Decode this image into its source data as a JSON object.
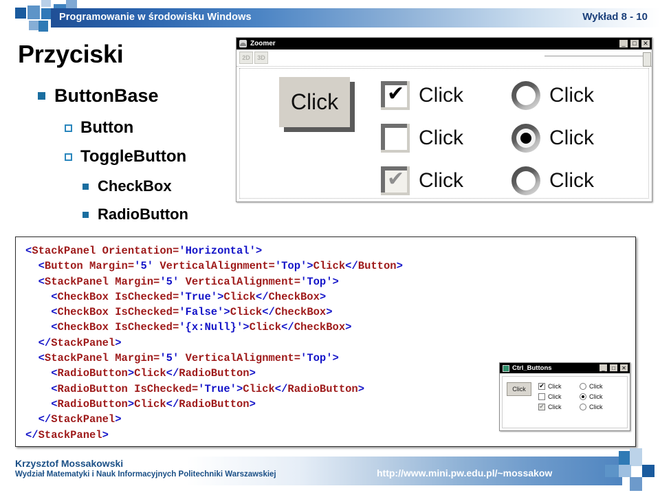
{
  "header": {
    "title": "Programowanie w środowisku Windows",
    "lecture": "Wykład 8 - 10"
  },
  "slide": {
    "title": "Przyciski",
    "bullets": [
      {
        "label": "ButtonBase",
        "marker": "filled-square"
      },
      {
        "label": "Button",
        "marker": "hollow-square"
      },
      {
        "label": "ToggleButton",
        "marker": "hollow-square"
      },
      {
        "label": "CheckBox",
        "marker": "filled-square-small"
      },
      {
        "label": "RadioButton",
        "marker": "filled-square-small"
      }
    ]
  },
  "zoomer_window": {
    "title": "Zoomer",
    "tools": [
      "2D",
      "3D"
    ],
    "controls": {
      "minimize": "_",
      "maximize": "□",
      "close": "✕"
    },
    "button_label": "Click",
    "checkboxes": [
      {
        "label": "Click",
        "state": "checked"
      },
      {
        "label": "Click",
        "state": "unchecked"
      },
      {
        "label": "Click",
        "state": "indeterminate"
      }
    ],
    "radios": [
      {
        "label": "Click",
        "state": "unselected"
      },
      {
        "label": "Click",
        "state": "selected"
      },
      {
        "label": "Click",
        "state": "unselected"
      }
    ]
  },
  "code": {
    "lines": [
      [
        {
          "t": "<",
          "c": "b"
        },
        {
          "t": "StackPanel ",
          "c": "r"
        },
        {
          "t": "Orientation=",
          "c": "r"
        },
        {
          "t": "'Horizontal'",
          "c": "b"
        },
        {
          "t": ">",
          "c": "b"
        }
      ],
      [
        {
          "t": "  <",
          "c": "b"
        },
        {
          "t": "Button ",
          "c": "r"
        },
        {
          "t": "Margin=",
          "c": "r"
        },
        {
          "t": "'5' ",
          "c": "b"
        },
        {
          "t": "VerticalAlignment=",
          "c": "r"
        },
        {
          "t": "'Top'",
          "c": "b"
        },
        {
          "t": ">",
          "c": "b"
        },
        {
          "t": "Click",
          "c": "r"
        },
        {
          "t": "</",
          "c": "b"
        },
        {
          "t": "Button",
          "c": "r"
        },
        {
          "t": ">",
          "c": "b"
        }
      ],
      [
        {
          "t": "  <",
          "c": "b"
        },
        {
          "t": "StackPanel ",
          "c": "r"
        },
        {
          "t": "Margin=",
          "c": "r"
        },
        {
          "t": "'5' ",
          "c": "b"
        },
        {
          "t": "VerticalAlignment=",
          "c": "r"
        },
        {
          "t": "'Top'",
          "c": "b"
        },
        {
          "t": ">",
          "c": "b"
        }
      ],
      [
        {
          "t": "    <",
          "c": "b"
        },
        {
          "t": "CheckBox ",
          "c": "r"
        },
        {
          "t": "IsChecked=",
          "c": "r"
        },
        {
          "t": "'True'",
          "c": "b"
        },
        {
          "t": ">",
          "c": "b"
        },
        {
          "t": "Click",
          "c": "r"
        },
        {
          "t": "</",
          "c": "b"
        },
        {
          "t": "CheckBox",
          "c": "r"
        },
        {
          "t": ">",
          "c": "b"
        }
      ],
      [
        {
          "t": "    <",
          "c": "b"
        },
        {
          "t": "CheckBox ",
          "c": "r"
        },
        {
          "t": "IsChecked=",
          "c": "r"
        },
        {
          "t": "'False'",
          "c": "b"
        },
        {
          "t": ">",
          "c": "b"
        },
        {
          "t": "Click",
          "c": "r"
        },
        {
          "t": "</",
          "c": "b"
        },
        {
          "t": "CheckBox",
          "c": "r"
        },
        {
          "t": ">",
          "c": "b"
        }
      ],
      [
        {
          "t": "    <",
          "c": "b"
        },
        {
          "t": "CheckBox ",
          "c": "r"
        },
        {
          "t": "IsChecked=",
          "c": "r"
        },
        {
          "t": "'{x:Null}'",
          "c": "b"
        },
        {
          "t": ">",
          "c": "b"
        },
        {
          "t": "Click",
          "c": "r"
        },
        {
          "t": "</",
          "c": "b"
        },
        {
          "t": "CheckBox",
          "c": "r"
        },
        {
          "t": ">",
          "c": "b"
        }
      ],
      [
        {
          "t": "  </",
          "c": "b"
        },
        {
          "t": "StackPanel",
          "c": "r"
        },
        {
          "t": ">",
          "c": "b"
        }
      ],
      [
        {
          "t": "  <",
          "c": "b"
        },
        {
          "t": "StackPanel ",
          "c": "r"
        },
        {
          "t": "Margin=",
          "c": "r"
        },
        {
          "t": "'5' ",
          "c": "b"
        },
        {
          "t": "VerticalAlignment=",
          "c": "r"
        },
        {
          "t": "'Top'",
          "c": "b"
        },
        {
          "t": ">",
          "c": "b"
        }
      ],
      [
        {
          "t": "    <",
          "c": "b"
        },
        {
          "t": "RadioButton",
          "c": "r"
        },
        {
          "t": ">",
          "c": "b"
        },
        {
          "t": "Click",
          "c": "r"
        },
        {
          "t": "</",
          "c": "b"
        },
        {
          "t": "RadioButton",
          "c": "r"
        },
        {
          "t": ">",
          "c": "b"
        }
      ],
      [
        {
          "t": "    <",
          "c": "b"
        },
        {
          "t": "RadioButton ",
          "c": "r"
        },
        {
          "t": "IsChecked=",
          "c": "r"
        },
        {
          "t": "'True'",
          "c": "b"
        },
        {
          "t": ">",
          "c": "b"
        },
        {
          "t": "Click",
          "c": "r"
        },
        {
          "t": "</",
          "c": "b"
        },
        {
          "t": "RadioButton",
          "c": "r"
        },
        {
          "t": ">",
          "c": "b"
        }
      ],
      [
        {
          "t": "    <",
          "c": "b"
        },
        {
          "t": "RadioButton",
          "c": "r"
        },
        {
          "t": ">",
          "c": "b"
        },
        {
          "t": "Click",
          "c": "r"
        },
        {
          "t": "</",
          "c": "b"
        },
        {
          "t": "RadioButton",
          "c": "r"
        },
        {
          "t": ">",
          "c": "b"
        }
      ],
      [
        {
          "t": "  </",
          "c": "b"
        },
        {
          "t": "StackPanel",
          "c": "r"
        },
        {
          "t": ">",
          "c": "b"
        }
      ],
      [
        {
          "t": "</",
          "c": "b"
        },
        {
          "t": "StackPanel",
          "c": "r"
        },
        {
          "t": ">",
          "c": "b"
        }
      ]
    ]
  },
  "ctrl_buttons_window": {
    "title": "Ctrl_Buttons",
    "controls": {
      "minimize": "_",
      "maximize": "□",
      "close": "✕"
    },
    "button_label": "Click",
    "checkboxes": [
      {
        "label": "Click",
        "state": "checked"
      },
      {
        "label": "Click",
        "state": "unchecked"
      },
      {
        "label": "Click",
        "state": "indeterminate"
      }
    ],
    "radios": [
      {
        "label": "Click",
        "state": "unselected"
      },
      {
        "label": "Click",
        "state": "selected"
      },
      {
        "label": "Click",
        "state": "unselected"
      }
    ]
  },
  "footer": {
    "name": "Krzysztof Mossakowski",
    "affiliation": "Wydział Matematyki i Nauk Informacyjnych Politechniki Warszawskiej",
    "url": "http://www.mini.pw.edu.pl/~mossakow"
  },
  "colors": {
    "header_blue": "#1f4f96",
    "bullet_blue": "#1a6ea0",
    "footer_text": "#1a4f86",
    "code_tag": "#9e1a1a",
    "code_value": "#1414c8"
  }
}
